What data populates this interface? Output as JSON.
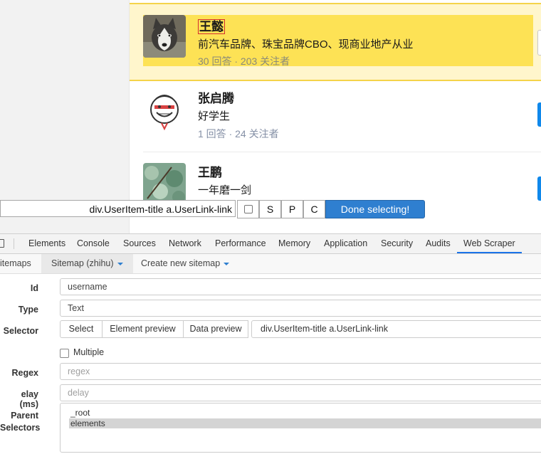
{
  "users": [
    {
      "name": "王懿",
      "headline": "前汽车品牌、珠宝品牌CBO、现商业地产从业",
      "stats": "30 回答 · 203 关注者"
    },
    {
      "name": "张启腾",
      "headline": "好学生",
      "stats": "1 回答 · 24 关注者"
    },
    {
      "name": "王鹏",
      "headline": "一年磨一剑",
      "stats": ""
    }
  ],
  "selector_bar": {
    "selector": "div.UserItem-title a.UserLink-link",
    "s_label": "S",
    "p_label": "P",
    "c_label": "C",
    "done_label": "Done selecting!"
  },
  "devtools": {
    "tabs": [
      "Elements",
      "Console",
      "Sources",
      "Network",
      "Performance",
      "Memory",
      "Application",
      "Security",
      "Audits",
      "Web Scraper"
    ],
    "active_tab": "Web Scraper"
  },
  "scraper_nav": {
    "sitemaps": "itemaps",
    "sitemap": "Sitemap (zhihu)",
    "create": "Create new sitemap"
  },
  "form": {
    "id_label": "Id",
    "id_value": "username",
    "type_label": "Type",
    "type_value": "Text",
    "selector_label": "Selector",
    "select_btn": "Select",
    "element_preview_btn": "Element preview",
    "data_preview_btn": "Data preview",
    "selector_value": "div.UserItem-title a.UserLink-link",
    "multiple_label": "Multiple",
    "regex_label": "Regex",
    "regex_placeholder": "regex",
    "delay_label": "elay (ms)",
    "delay_placeholder": "delay",
    "parent_label_1": "Parent",
    "parent_label_2": "Selectors",
    "parent_options": [
      "_root",
      "elements"
    ]
  },
  "colors": {
    "highlight": "#fde255",
    "accent": "#2f7fd0",
    "zhihu_blue": "#0f88eb"
  }
}
